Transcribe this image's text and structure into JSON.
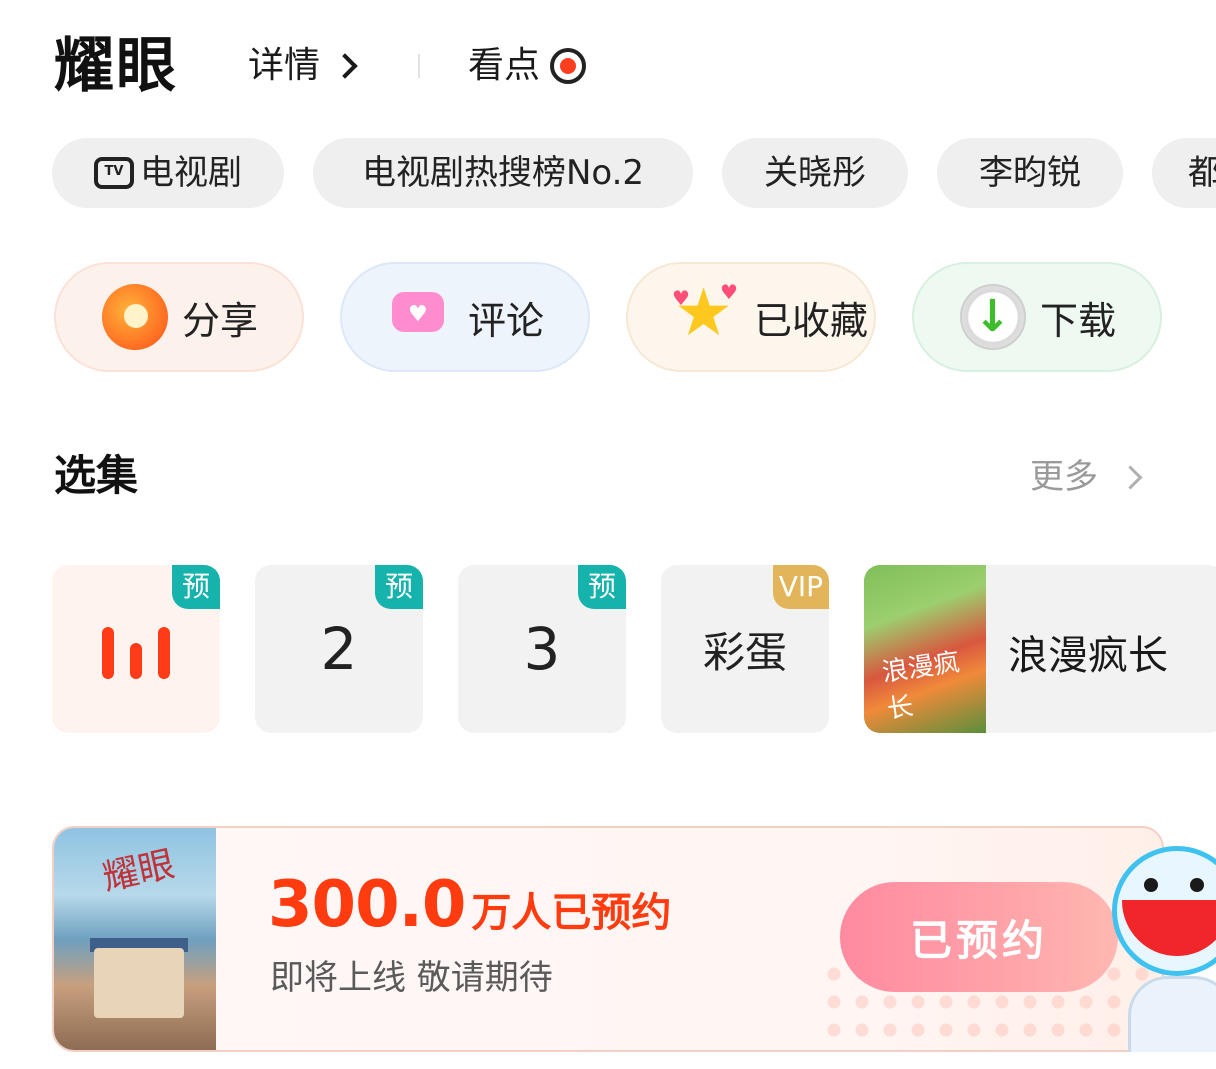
{
  "header": {
    "title": "耀眼",
    "detail_link": "详情",
    "highlights_link": "看点"
  },
  "tags": [
    {
      "label": "电视剧",
      "icon": "tv-icon"
    },
    {
      "label": "电视剧热搜榜No.2"
    },
    {
      "label": "关晓彤"
    },
    {
      "label": "李昀锐"
    },
    {
      "label": "都"
    }
  ],
  "actions": {
    "share": "分享",
    "comment": "评论",
    "favorite": "已收藏",
    "download": "下载"
  },
  "episodes": {
    "section_title": "选集",
    "more_label": "更多",
    "items": [
      {
        "badge": "预",
        "playing": true
      },
      {
        "number": "2",
        "badge": "预"
      },
      {
        "number": "3",
        "badge": "预"
      },
      {
        "number": "彩蛋",
        "badge": "VIP"
      }
    ],
    "featured": {
      "label": "浪漫疯长",
      "thumb_text": "浪漫疯长"
    }
  },
  "reservation": {
    "poster_text": "耀眼",
    "count": "300.0",
    "count_unit": "万人已预约",
    "subtitle": "即将上线 敬请期待",
    "button": "已预约"
  },
  "colors": {
    "accent_orange": "#ff3b0f",
    "badge_teal": "#16b3ad",
    "badge_vip": "#e3b55a",
    "button_pink": "#ff8aa0"
  }
}
